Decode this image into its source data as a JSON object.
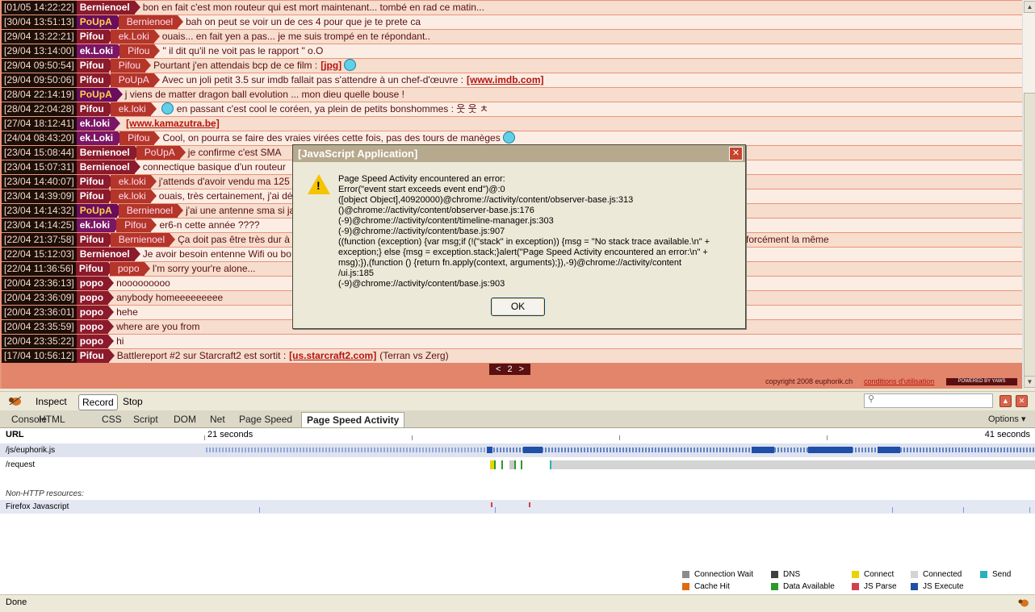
{
  "chat": {
    "messages": [
      {
        "ts": "[01/05 14:22:22]",
        "nick": "Bernienoel",
        "nick_class": "c-bernienoel",
        "to": "",
        "text": "bon en fait c'est mon routeur qui est mort maintenant... tombé en rad ce matin..."
      },
      {
        "ts": "[30/04 13:51:13]",
        "nick": "PoUpA",
        "nick_class": "c-poupa",
        "to": "Bernienoel",
        "text": "bah on peut se voir un de ces 4 pour que je te prete ca"
      },
      {
        "ts": "[29/04 13:22:21]",
        "nick": "Pifou",
        "nick_class": "c-pifou",
        "to": "ek.Loki",
        "text": "ouais... en fait yen a pas... je me suis trompé en te répondant.."
      },
      {
        "ts": "[29/04 13:14:00]",
        "nick": "ek.Loki",
        "nick_class": "c-ekloki",
        "to": "Pifou",
        "text": "\" il dit qu'il ne voit pas le rapport \" o.O"
      },
      {
        "ts": "[29/04 09:50:54]",
        "nick": "Pifou",
        "nick_class": "c-pifou",
        "to": "Pifou",
        "text": "Pourtant j'en attendais bcp de ce film :",
        "link": "[jpg]",
        "smiley": true
      },
      {
        "ts": "[29/04 09:50:06]",
        "nick": "Pifou",
        "nick_class": "c-pifou",
        "to": "PoUpA",
        "text": "Avec un joli petit 3.5 sur imdb fallait pas s'attendre à un chef-d'œuvre :",
        "link": "[www.imdb.com]"
      },
      {
        "ts": "[28/04 22:14:19]",
        "nick": "PoUpA",
        "nick_class": "c-poupa",
        "to": "",
        "text": "j viens de matter dragon ball evolution ... mon dieu quelle bouse !"
      },
      {
        "ts": "[28/04 22:04:28]",
        "nick": "Pifou",
        "nick_class": "c-pifou",
        "to": "ek.loki",
        "text": "en passant c'est cool le coréen, ya plein de petits bonshommes : 웃 웃 ㅊ",
        "smiley_before": true
      },
      {
        "ts": "[27/04 18:12:41]",
        "nick": "ek.loki",
        "nick_class": "c-ekloki",
        "to": "",
        "text": "",
        "link": "[www.kamazutra.be]"
      },
      {
        "ts": "[24/04 08:43:20]",
        "nick": "ek.Loki",
        "nick_class": "c-ekloki",
        "to": "Pifou",
        "text": "Cool, on pourra se faire des vraies virées cette fois, pas des tours de manèges",
        "smiley": true
      },
      {
        "ts": "[23/04 15:08:44]",
        "nick": "Bernienoel",
        "nick_class": "c-bernienoel",
        "to": "PoUpA",
        "text": "je confirme c'est SMA"
      },
      {
        "ts": "[23/04 15:07:31]",
        "nick": "Bernienoel",
        "nick_class": "c-bernienoel",
        "to": "",
        "text": "connectique basique d'un routeur"
      },
      {
        "ts": "[23/04 14:40:07]",
        "nick": "Pifou",
        "nick_class": "c-pifou",
        "to": "ek.loki",
        "text": "j'attends d'avoir vendu ma 125"
      },
      {
        "ts": "[23/04 14:39:09]",
        "nick": "Pifou",
        "nick_class": "c-pifou",
        "to": "ek.loki",
        "text": "ouais, très certainement, j'ai déj"
      },
      {
        "ts": "[23/04 14:14:32]",
        "nick": "PoUpA",
        "nick_class": "c-poupa",
        "to": "Bernienoel",
        "text": "j'ai une antenne sma si ja"
      },
      {
        "ts": "[23/04 14:14:25]",
        "nick": "ek.loki",
        "nick_class": "c-ekloki",
        "to": "Pifou",
        "text": "er6-n cette année ????"
      },
      {
        "ts": "[22/04 21:37:58]",
        "nick": "Pifou",
        "nick_class": "c-pifou",
        "to": "Bernienoel",
        "text": "Ça doit pas être très dur à r",
        "tail": "forcément la même"
      },
      {
        "ts": "[22/04 15:12:03]",
        "nick": "Bernienoel",
        "nick_class": "c-bernienoel",
        "to": "",
        "text": "Je avoir besoin entenne Wifi ou bo"
      },
      {
        "ts": "[22/04 11:36:56]",
        "nick": "Pifou",
        "nick_class": "c-pifou",
        "to": "popo",
        "text": "I'm sorry your're alone..."
      },
      {
        "ts": "[20/04 23:36:13]",
        "nick": "popo",
        "nick_class": "c-popo",
        "to": "",
        "text": "nooooooooo"
      },
      {
        "ts": "[20/04 23:36:09]",
        "nick": "popo",
        "nick_class": "c-popo",
        "to": "",
        "text": "anybody homeeeeeeeee"
      },
      {
        "ts": "[20/04 23:36:01]",
        "nick": "popo",
        "nick_class": "c-popo",
        "to": "",
        "text": "hehe"
      },
      {
        "ts": "[20/04 23:35:59]",
        "nick": "popo",
        "nick_class": "c-popo",
        "to": "",
        "text": "where are you from"
      },
      {
        "ts": "[20/04 23:35:22]",
        "nick": "popo",
        "nick_class": "c-popo",
        "to": "",
        "text": "hi"
      },
      {
        "ts": "[17/04 10:56:12]",
        "nick": "Pifou",
        "nick_class": "c-pifou",
        "to": "",
        "text": "Battlereport #2 sur Starcraft2 est sortit :",
        "link": "[us.starcraft2.com]",
        "after": "(Terran vs Zerg)"
      }
    ],
    "pager": {
      "prev": "<",
      "page": "2",
      "next": ">"
    },
    "copyright": "copyright 2008 euphorik.ch",
    "cgu": "conditions d'utilisation",
    "powered": "POWERED BY YAWS"
  },
  "dialog": {
    "title": "[JavaScript Application]",
    "close": "✕",
    "message": "Page Speed Activity encountered an error:\nError(\"event start exceeds event end\")@:0\n([object Object],40920000)@chrome://activity/content/observer-base.js:313\n()@chrome://activity/content/observer-base.js:176\n(-9)@chrome://activity/content/timeline-manager.js:303\n(-9)@chrome://activity/content/base.js:907\n((function (exception) {var msg;if (!(\"stack\" in exception)) {msg = \"No stack trace available.\\n\" +\nexception;} else {msg = exception.stack;}alert(\"Page Speed Activity encountered an error:\\n\" +\nmsg);}),(function () {return fn.apply(context, arguments);}),-9)@chrome://activity/content\n/ui.js:185\n(-9)@chrome://activity/content/base.js:903",
    "ok": "OK"
  },
  "firebug": {
    "toolbar": {
      "inspect": "Inspect",
      "record": "Record",
      "stop": "Stop"
    },
    "tabs": [
      "Console",
      "HTML",
      "CSS",
      "Script",
      "DOM",
      "Net",
      "Page Speed",
      "Page Speed Activity"
    ],
    "active_tab": "Page Speed Activity",
    "options": "Options ▾",
    "panel": {
      "url_header": "URL",
      "time_start": "21 seconds",
      "time_end": "41 seconds",
      "rows": [
        "/js/euphorik.js",
        "/request",
        "Non-HTTP resources:",
        "Firefox Javascript"
      ]
    },
    "legend": [
      {
        "label": "Connection Wait",
        "color": "#8c8c8c"
      },
      {
        "label": "DNS",
        "color": "#404040"
      },
      {
        "label": "Connect",
        "color": "#e8d400"
      },
      {
        "label": "Connected",
        "color": "#d4d4d4"
      },
      {
        "label": "Send",
        "color": "#2ab0b8"
      },
      {
        "label": "Cache Hit",
        "color": "#e06a10"
      },
      {
        "label": "Data Available",
        "color": "#2a9a2a"
      },
      {
        "label": "JS Parse",
        "color": "#d04050"
      },
      {
        "label": "JS Execute",
        "color": "#1f4fa8"
      }
    ]
  },
  "status": {
    "text": "Done"
  }
}
